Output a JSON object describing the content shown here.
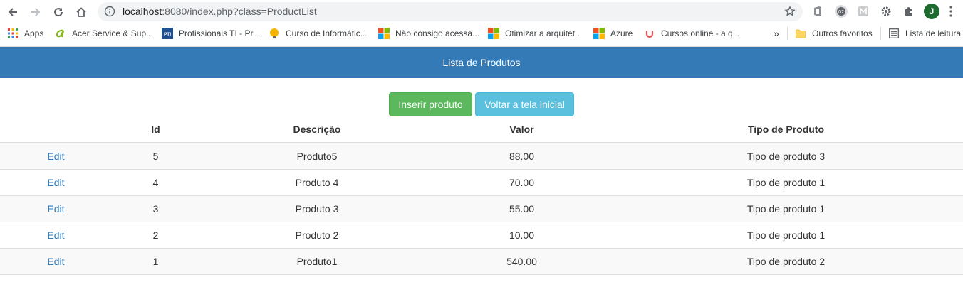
{
  "browser": {
    "url_host": "localhost",
    "url_rest": ":8080/index.php?class=ProductList",
    "profile_initial": "J",
    "bookmarks": [
      {
        "label": "Apps",
        "icon": "apps-grid-icon"
      },
      {
        "label": "Acer Service & Sup...",
        "icon": "acer-icon"
      },
      {
        "label": "Profissionais TI - Pr...",
        "icon": "pti-icon"
      },
      {
        "label": "Curso de Informátic...",
        "icon": "bulb-icon"
      },
      {
        "label": "Não consigo acessa...",
        "icon": "microsoft-icon"
      },
      {
        "label": "Otimizar a arquitet...",
        "icon": "microsoft-icon"
      },
      {
        "label": "Azure",
        "icon": "microsoft-icon"
      },
      {
        "label": "Cursos online - a q...",
        "icon": "udemy-icon"
      }
    ],
    "overflow_label": "»",
    "other_favorites": "Outros favoritos",
    "reading_list": "Lista de leitura"
  },
  "page": {
    "header_title": "Lista de Produtos",
    "insert_button": "Inserir produto",
    "back_button": "Voltar a tela inicial"
  },
  "table": {
    "columns": [
      "",
      "Id",
      "Descrição",
      "Valor",
      "Tipo de Produto"
    ],
    "edit_label": "Edit",
    "rows": [
      {
        "id": "5",
        "descricao": "Produto5",
        "valor": "88.00",
        "tipo": "Tipo de produto 3"
      },
      {
        "id": "4",
        "descricao": "Produto 4",
        "valor": "70.00",
        "tipo": "Tipo de produto 1"
      },
      {
        "id": "3",
        "descricao": "Produto 3",
        "valor": "55.00",
        "tipo": "Tipo de produto 1"
      },
      {
        "id": "2",
        "descricao": "Produto 2",
        "valor": "10.00",
        "tipo": "Tipo de produto 1"
      },
      {
        "id": "1",
        "descricao": "Produto1",
        "valor": "540.00",
        "tipo": "Tipo de produto 2"
      }
    ]
  },
  "colors": {
    "header_bg": "#337ab7",
    "success": "#5cb85c",
    "info": "#5bc0de",
    "link": "#337ab7"
  }
}
